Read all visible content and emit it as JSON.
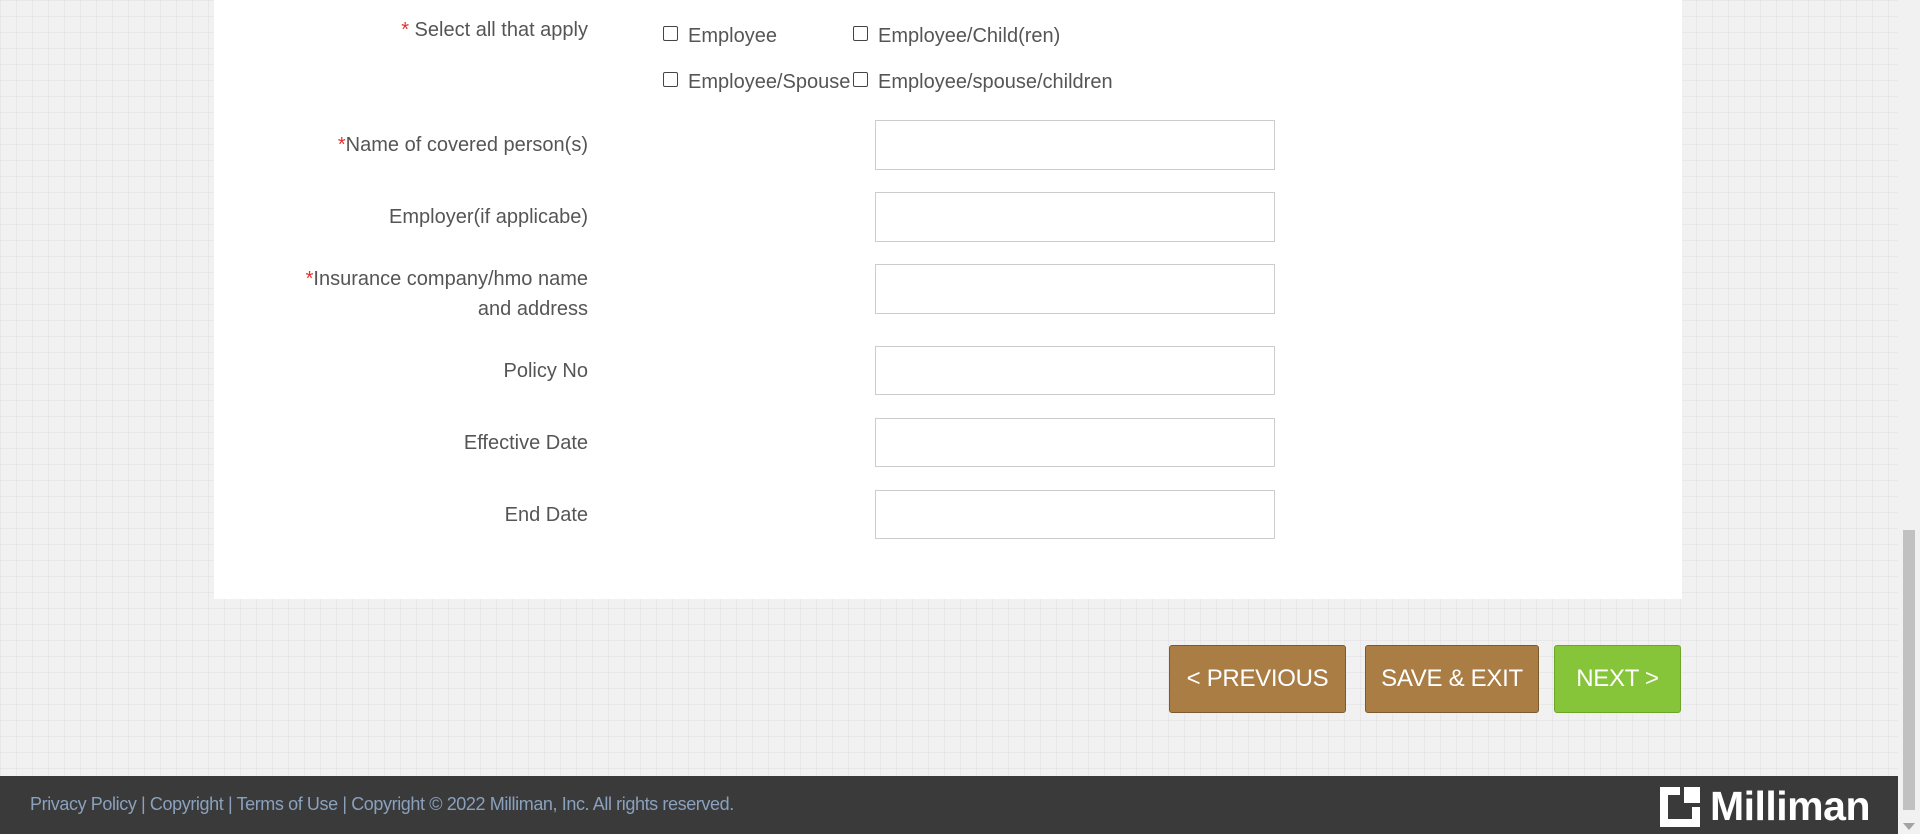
{
  "form": {
    "coverage": {
      "required_mark": "*",
      "label": " Select all that apply",
      "options": [
        "Employee",
        "Employee/Child(ren)",
        "Employee/Spouse",
        "Employee/spouse/children"
      ]
    },
    "fields": {
      "name_covered": {
        "required_mark": "*",
        "label": "Name of covered person(s)",
        "value": ""
      },
      "employer": {
        "label": "Employer(if applicabe)",
        "value": ""
      },
      "insurance": {
        "required_mark": "*",
        "label_line1": "Insurance company/hmo name",
        "label_line2": "and address",
        "value": ""
      },
      "policy_no": {
        "label": "Policy No",
        "value": ""
      },
      "effective_date": {
        "label": "Effective Date",
        "value": ""
      },
      "end_date": {
        "label": "End Date",
        "value": ""
      }
    }
  },
  "nav": {
    "previous": "< PREVIOUS",
    "save_exit": "SAVE & EXIT",
    "next": "NEXT >"
  },
  "footer": {
    "links": "Privacy Policy | Copyright | Terms of Use | Copyright © 2022 Milliman, Inc. All rights reserved.",
    "brand": "Milliman"
  },
  "colors": {
    "brown_button": "#a97d43",
    "green_button": "#86c43a",
    "required": "#e03030",
    "footer_bg": "#3a3a3a",
    "footer_link": "#8aa1bd"
  },
  "icons": [
    "milliman-logo-icon",
    "checkbox-icon",
    "scroll-down-arrow-icon"
  ]
}
